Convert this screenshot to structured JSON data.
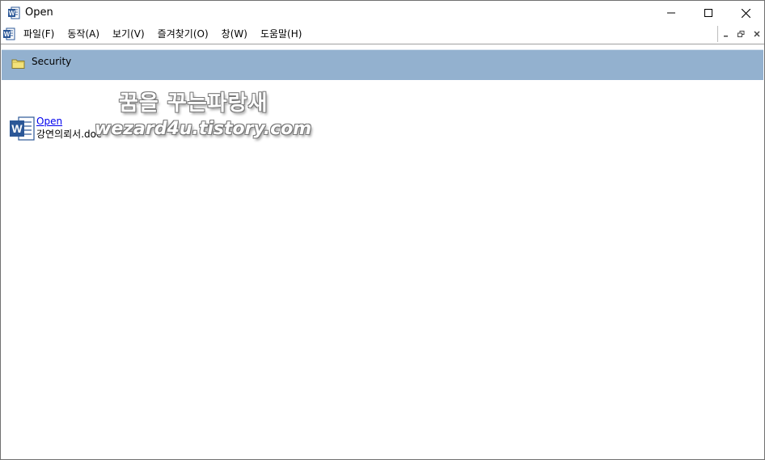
{
  "window": {
    "title": "Open",
    "icon": "word-app-icon"
  },
  "menu": {
    "items": [
      {
        "label": "파일(F)"
      },
      {
        "label": "동작(A)"
      },
      {
        "label": "보기(V)"
      },
      {
        "label": "즐겨찾기(O)"
      },
      {
        "label": "창(W)"
      },
      {
        "label": "도움말(H)"
      }
    ]
  },
  "header": {
    "label": "Security",
    "icon": "folder-icon"
  },
  "item": {
    "link": "Open",
    "filename": "강연의뢰서.doc",
    "icon": "word-doc-icon"
  },
  "watermark": {
    "line1": "꿈을 꾸는파랑새",
    "line2": "wezard4u.tistory.com"
  },
  "colors": {
    "header_band": "#93b1cf",
    "link": "#0000ee",
    "word_blue": "#2b5797"
  }
}
